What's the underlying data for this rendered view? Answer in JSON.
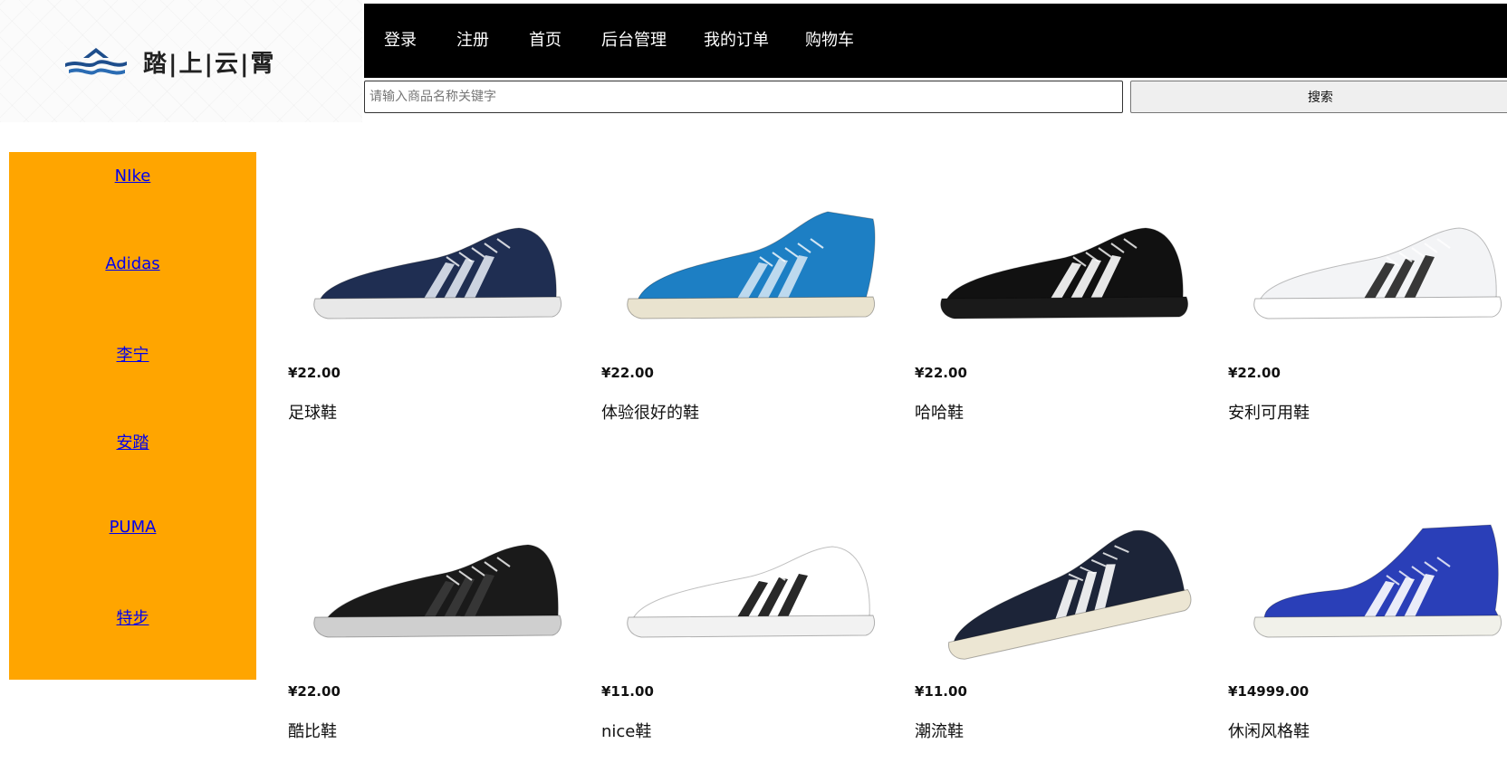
{
  "logo": {
    "text": "踏|上|云|霄"
  },
  "nav": {
    "items": [
      {
        "label": "登录",
        "name": "nav-login"
      },
      {
        "label": "注册",
        "name": "nav-register"
      },
      {
        "label": "首页",
        "name": "nav-home"
      },
      {
        "label": "后台管理",
        "name": "nav-admin"
      },
      {
        "label": "我的订单",
        "name": "nav-my-orders"
      },
      {
        "label": "购物车",
        "name": "nav-cart"
      }
    ]
  },
  "search": {
    "placeholder": "请输入商品名称关键字",
    "value": "",
    "button_label": "搜索"
  },
  "sidebar": {
    "brands": [
      "NIke",
      "Adidas",
      "李宁",
      "安踏",
      "PUMA",
      "特步"
    ]
  },
  "products": [
    {
      "price": "¥22.00",
      "name": "足球鞋",
      "shoe_color": "#1f2e52",
      "sole_color": "#e8e8e8",
      "stripe_color": "#dfe5ef",
      "style": "low"
    },
    {
      "price": "¥22.00",
      "name": "体验很好的鞋",
      "shoe_color": "#1d7fc4",
      "sole_color": "#e9e3cf",
      "stripe_color": "#cfe3f3",
      "style": "water"
    },
    {
      "price": "¥22.00",
      "name": "哈哈鞋",
      "shoe_color": "#111111",
      "sole_color": "#1a1a1a",
      "stripe_color": "#ffffff",
      "style": "low"
    },
    {
      "price": "¥22.00",
      "name": "安利可用鞋",
      "shoe_color": "#f3f4f6",
      "sole_color": "#ffffff",
      "stripe_color": "#222222",
      "style": "low"
    },
    {
      "price": "¥22.00",
      "name": "酷比鞋",
      "shoe_color": "#1a1a1a",
      "sole_color": "#cfcfcf",
      "stripe_color": "#3a3a3a",
      "style": "runner"
    },
    {
      "price": "¥11.00",
      "name": "nice鞋",
      "shoe_color": "#ffffff",
      "sole_color": "#f2f2f2",
      "stripe_color": "#111111",
      "style": "low"
    },
    {
      "price": "¥11.00",
      "name": "潮流鞋",
      "shoe_color": "#1c2438",
      "sole_color": "#ece6d3",
      "stripe_color": "#ffffff",
      "style": "tilt"
    },
    {
      "price": "¥14999.00",
      "name": "休闲风格鞋",
      "shoe_color": "#2a3fb8",
      "sole_color": "#f1f1ea",
      "stripe_color": "#ffffff",
      "style": "high"
    }
  ],
  "colors": {
    "nav_bg": "#000000",
    "sidebar_bg": "#ffa500",
    "link": "#0000ee"
  }
}
